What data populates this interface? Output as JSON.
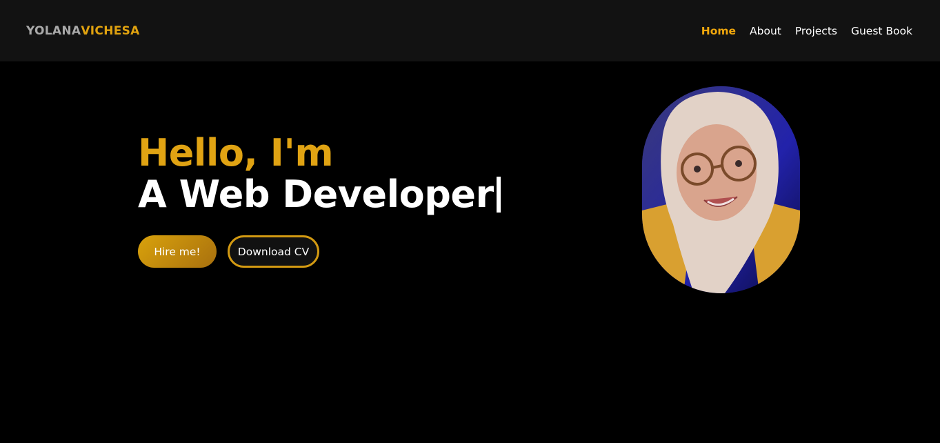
{
  "brand": {
    "first": "YOLANA",
    "second": "VICHESA"
  },
  "nav": {
    "items": [
      {
        "label": "Home",
        "active": true
      },
      {
        "label": "About",
        "active": false
      },
      {
        "label": "Projects",
        "active": false
      },
      {
        "label": "Guest Book",
        "active": false
      }
    ]
  },
  "hero": {
    "greeting": "Hello, I'm",
    "role": "A Web Developer",
    "hire_label": "Hire me!",
    "cv_label": "Download CV"
  },
  "colors": {
    "accent": "#e0a313",
    "navbar_bg": "#121212",
    "page_bg": "#000000"
  },
  "profile_photo": {
    "icon": "profile-photo"
  }
}
